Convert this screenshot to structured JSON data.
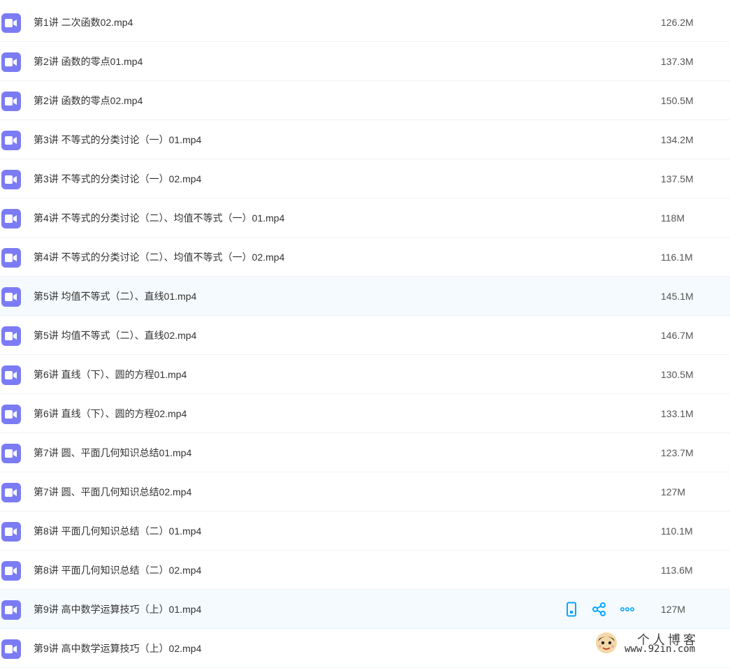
{
  "colors": {
    "video_icon": "#7b7cf4",
    "action_icon": "#06a7ff",
    "row_highlight": "#f5fafe"
  },
  "files": [
    {
      "name": "第1讲 二次函数02.mp4",
      "size": "126.2M",
      "icon": "video-file-icon"
    },
    {
      "name": "第2讲 函数的零点01.mp4",
      "size": "137.3M",
      "icon": "video-file-icon"
    },
    {
      "name": "第2讲 函数的零点02.mp4",
      "size": "150.5M",
      "icon": "video-file-icon"
    },
    {
      "name": "第3讲 不等式的分类讨论（一）01.mp4",
      "size": "134.2M",
      "icon": "video-file-icon"
    },
    {
      "name": "第3讲 不等式的分类讨论（一）02.mp4",
      "size": "137.5M",
      "icon": "video-file-icon"
    },
    {
      "name": "第4讲 不等式的分类讨论（二）、均值不等式（一）01.mp4",
      "size": "118M",
      "icon": "video-file-icon"
    },
    {
      "name": "第4讲 不等式的分类讨论（二）、均值不等式（一）02.mp4",
      "size": "116.1M",
      "icon": "video-file-icon"
    },
    {
      "name": "第5讲 均值不等式（二）、直线01.mp4",
      "size": "145.1M",
      "icon": "video-file-icon",
      "selected": true
    },
    {
      "name": "第5讲 均值不等式（二）、直线02.mp4",
      "size": "146.7M",
      "icon": "video-file-icon"
    },
    {
      "name": "第6讲 直线（下）、圆的方程01.mp4",
      "size": "130.5M",
      "icon": "video-file-icon"
    },
    {
      "name": "第6讲 直线（下）、圆的方程02.mp4",
      "size": "133.1M",
      "icon": "video-file-icon"
    },
    {
      "name": "第7讲 圆、平面几何知识总结01.mp4",
      "size": "123.7M",
      "icon": "video-file-icon"
    },
    {
      "name": "第7讲 圆、平面几何知识总结02.mp4",
      "size": "127M",
      "icon": "video-file-icon"
    },
    {
      "name": "第8讲 平面几何知识总结（二）01.mp4",
      "size": "110.1M",
      "icon": "video-file-icon"
    },
    {
      "name": "第8讲 平面几何知识总结（二）02.mp4",
      "size": "113.6M",
      "icon": "video-file-icon"
    },
    {
      "name": "第9讲 高中数学运算技巧（上）01.mp4",
      "size": "127M",
      "icon": "video-file-icon",
      "hovered": true
    },
    {
      "name": "第9讲 高中数学运算技巧（上）02.mp4",
      "size": "",
      "icon": "video-file-icon"
    }
  ],
  "hover_actions": [
    {
      "icon": "phone-icon",
      "name": "send-to-phone-button"
    },
    {
      "icon": "share-icon",
      "name": "share-button"
    },
    {
      "icon": "more-icon",
      "name": "more-button"
    }
  ],
  "watermark": {
    "title": "个人博客",
    "url": "www.92in.com"
  }
}
